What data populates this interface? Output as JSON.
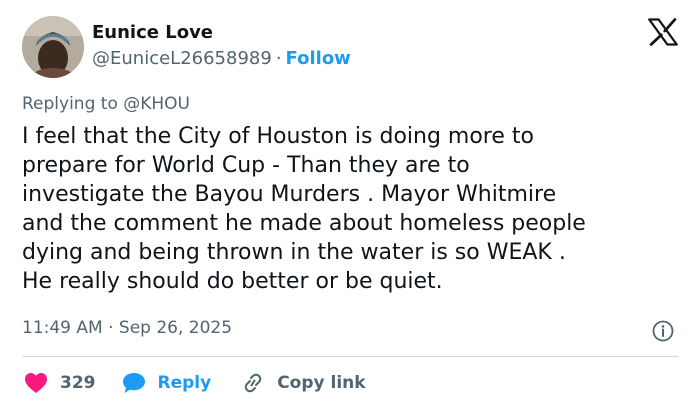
{
  "author": {
    "name": "Eunice Love",
    "handle": "@EuniceL26658989",
    "separator": "·",
    "follow_label": "Follow"
  },
  "tweet": {
    "replying_to": "Replying to @KHOU",
    "text": "I feel that the City of Houston is doing more to\nprepare for World  Cup - Than they are to\ninvestigate the Bayou Murders . Mayor Whitmire\nand the comment he made about homeless people\ndying and being thrown in the water is so  WEAK .\nHe really should do better or be quiet.",
    "timestamp": "11:49 AM · Sep 26, 2025"
  },
  "actions": {
    "likes_count": "329",
    "reply_label": "Reply",
    "copy_link_label": "Copy link"
  },
  "icons": {
    "logo": "x-logo-icon",
    "info": "info-icon",
    "like": "heart-icon",
    "reply": "speech-bubble-icon",
    "copy": "link-icon"
  },
  "colors": {
    "accent": "#1d9bf0",
    "heart": "#f91880",
    "text": "#0f1419",
    "muted": "#536471"
  }
}
